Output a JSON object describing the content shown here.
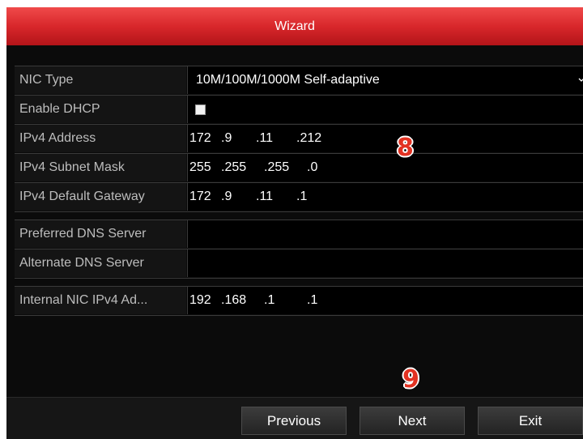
{
  "window": {
    "title": "Wizard"
  },
  "form": {
    "nic_type": {
      "label": "NIC Type",
      "value": "10M/100M/1000M Self-adaptive"
    },
    "enable_dhcp": {
      "label": "Enable DHCP",
      "checked": false
    },
    "ipv4_address": {
      "label": "IPv4 Address",
      "octets": [
        "172",
        ".9",
        ".11",
        ".212"
      ]
    },
    "ipv4_subnet_mask": {
      "label": "IPv4 Subnet Mask",
      "octets": [
        "255",
        ".255",
        ".255",
        ".0"
      ]
    },
    "ipv4_default_gateway": {
      "label": "IPv4 Default Gateway",
      "octets": [
        "172",
        ".9",
        ".11",
        ".1"
      ]
    },
    "preferred_dns_server": {
      "label": "Preferred DNS Server",
      "value": ""
    },
    "alternate_dns_server": {
      "label": "Alternate DNS Server",
      "value": ""
    },
    "internal_nic_ipv4": {
      "label": "Internal NIC IPv4 Ad...",
      "octets": [
        "192",
        ".168",
        ".1",
        ".1"
      ]
    }
  },
  "buttons": {
    "previous": "Previous",
    "next": "Next",
    "exit": "Exit"
  },
  "annotations": {
    "step_8": "8",
    "step_9": "9"
  },
  "colors": {
    "title_bar": "#d8272b",
    "background": "#0b0b0b",
    "annotation": "#e23222"
  },
  "icons": {
    "dropdown": "chevron-down-icon"
  }
}
